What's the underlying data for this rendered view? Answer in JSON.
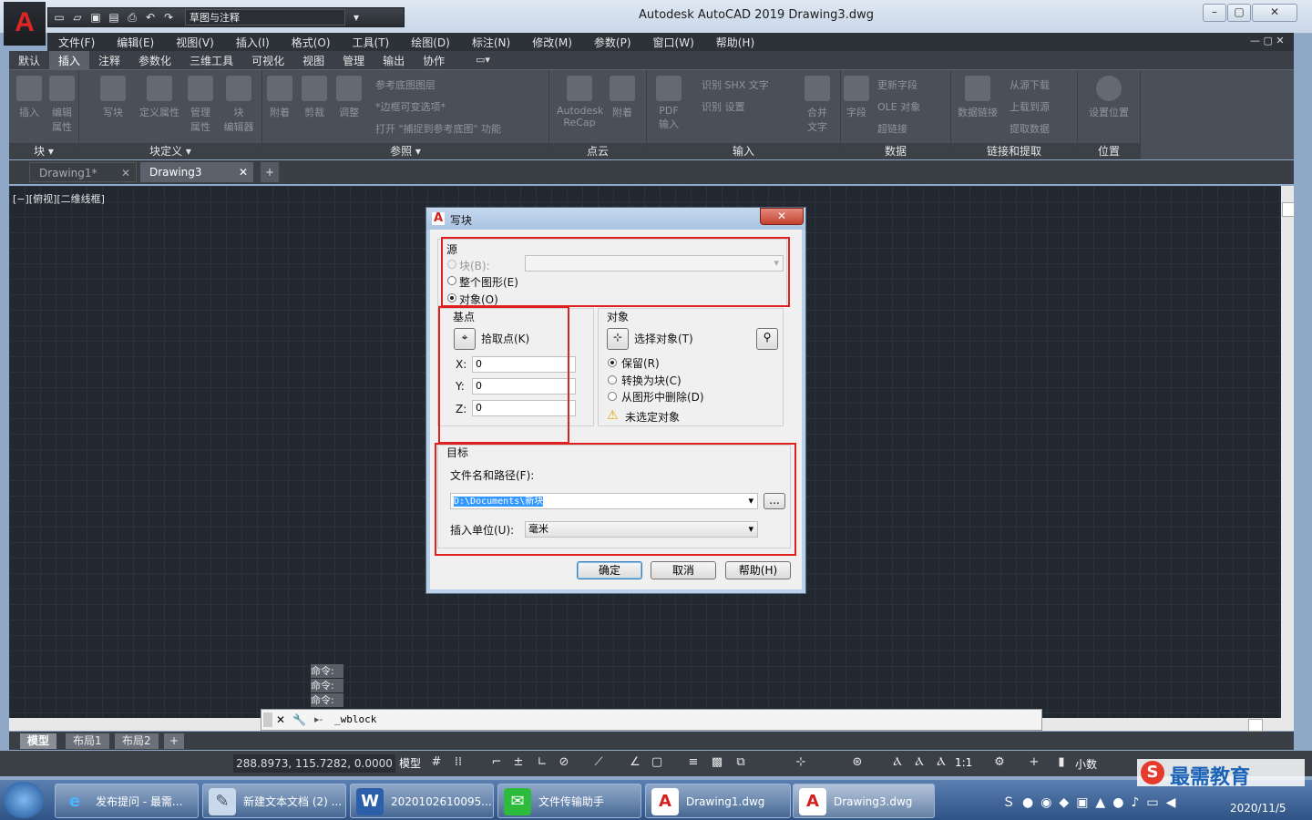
{
  "app": {
    "logo": "A",
    "title": "Autodesk AutoCAD 2019    Drawing3.dwg",
    "workspace": "草图与注释"
  },
  "menu": [
    "文件(F)",
    "编辑(E)",
    "视图(V)",
    "插入(I)",
    "格式(O)",
    "工具(T)",
    "绘图(D)",
    "标注(N)",
    "修改(M)",
    "参数(P)",
    "窗口(W)",
    "帮助(H)"
  ],
  "ribbon_tabs": [
    "默认",
    "插入",
    "注释",
    "参数化",
    "三维工具",
    "可视化",
    "视图",
    "管理",
    "输出",
    "协作"
  ],
  "ribbon": {
    "block_panel": {
      "title": "块 ▾",
      "items": [
        "插入",
        "编辑\n属性"
      ]
    },
    "blockdef_panel": {
      "title": "块定义 ▾",
      "items": [
        "写块",
        "定义属性",
        "管理\n属性",
        "块\n编辑器"
      ]
    },
    "reference_panel": {
      "title": "参照 ▾",
      "items": [
        "附着",
        "剪裁",
        "调整"
      ],
      "small": [
        "参考底图图层",
        "*边框可变选项*",
        "打开 \"捕捉到参考底图\" 功能"
      ]
    },
    "pointcloud_panel": {
      "title": "点云",
      "items": [
        "Autodesk\nReCap",
        "附着"
      ]
    },
    "import_panel": {
      "title": "输入",
      "items": [
        "PDF\n输入"
      ],
      "small": [
        "识别 SHX 文字",
        "识别 设置"
      ]
    },
    "data_panel": {
      "title": "数据",
      "items": [
        "合并\n文字",
        "字段"
      ],
      "small": [
        "更新字段",
        "OLE 对象",
        "超链接"
      ]
    },
    "link_panel": {
      "title": "链接和提取",
      "items": [
        "数据链接"
      ],
      "small": [
        "从源下载",
        "上载到源",
        "提取数据"
      ]
    },
    "location_panel": {
      "title": "位置",
      "items": [
        "设置位置"
      ]
    }
  },
  "doc_tabs": [
    "Drawing1*",
    "Drawing3"
  ],
  "viewport_label": "[−][俯视][二维线框]",
  "command": {
    "history": [
      "命令:",
      "命令:",
      "命令:"
    ],
    "current": "_wblock"
  },
  "layout_tabs": [
    "模型",
    "布局1",
    "布局2"
  ],
  "status": {
    "coords": "288.8973, 115.7282, 0.0000",
    "model": "模型",
    "scale": "1:1",
    "units": "小数"
  },
  "dialog": {
    "title": "写块",
    "source": {
      "heading": "源",
      "block": "块(B):",
      "entire": "整个图形(E)",
      "objects": "对象(O)"
    },
    "basepoint": {
      "heading": "基点",
      "pick": "拾取点(K)",
      "x_label": "X:",
      "x": "0",
      "y_label": "Y:",
      "y": "0",
      "z_label": "Z:",
      "z": "0"
    },
    "objects": {
      "heading": "对象",
      "select": "选择对象(T)",
      "retain": "保留(R)",
      "convert": "转换为块(C)",
      "delete": "从图形中删除(D)",
      "none_selected": "未选定对象"
    },
    "destination": {
      "heading": "目标",
      "filename_label": "文件名和路径(F):",
      "filename": "D:\\Documents\\新块",
      "browse": "...",
      "units_label": "插入单位(U):",
      "units": "毫米"
    },
    "buttons": {
      "ok": "确定",
      "cancel": "取消",
      "help": "帮助(H)"
    }
  },
  "taskbar": {
    "items": [
      "发布提问 - 最需...",
      "新建文本文档 (2) ...",
      "2020102610095...",
      "文件传输助手",
      "Drawing1.dwg",
      "Drawing3.dwg"
    ],
    "date": "2020/11/5",
    "watermark": "最需教育"
  },
  "colors": {
    "accent_red": "#e0201f",
    "canvas": "#212830",
    "ribbon": "#4a5059"
  }
}
